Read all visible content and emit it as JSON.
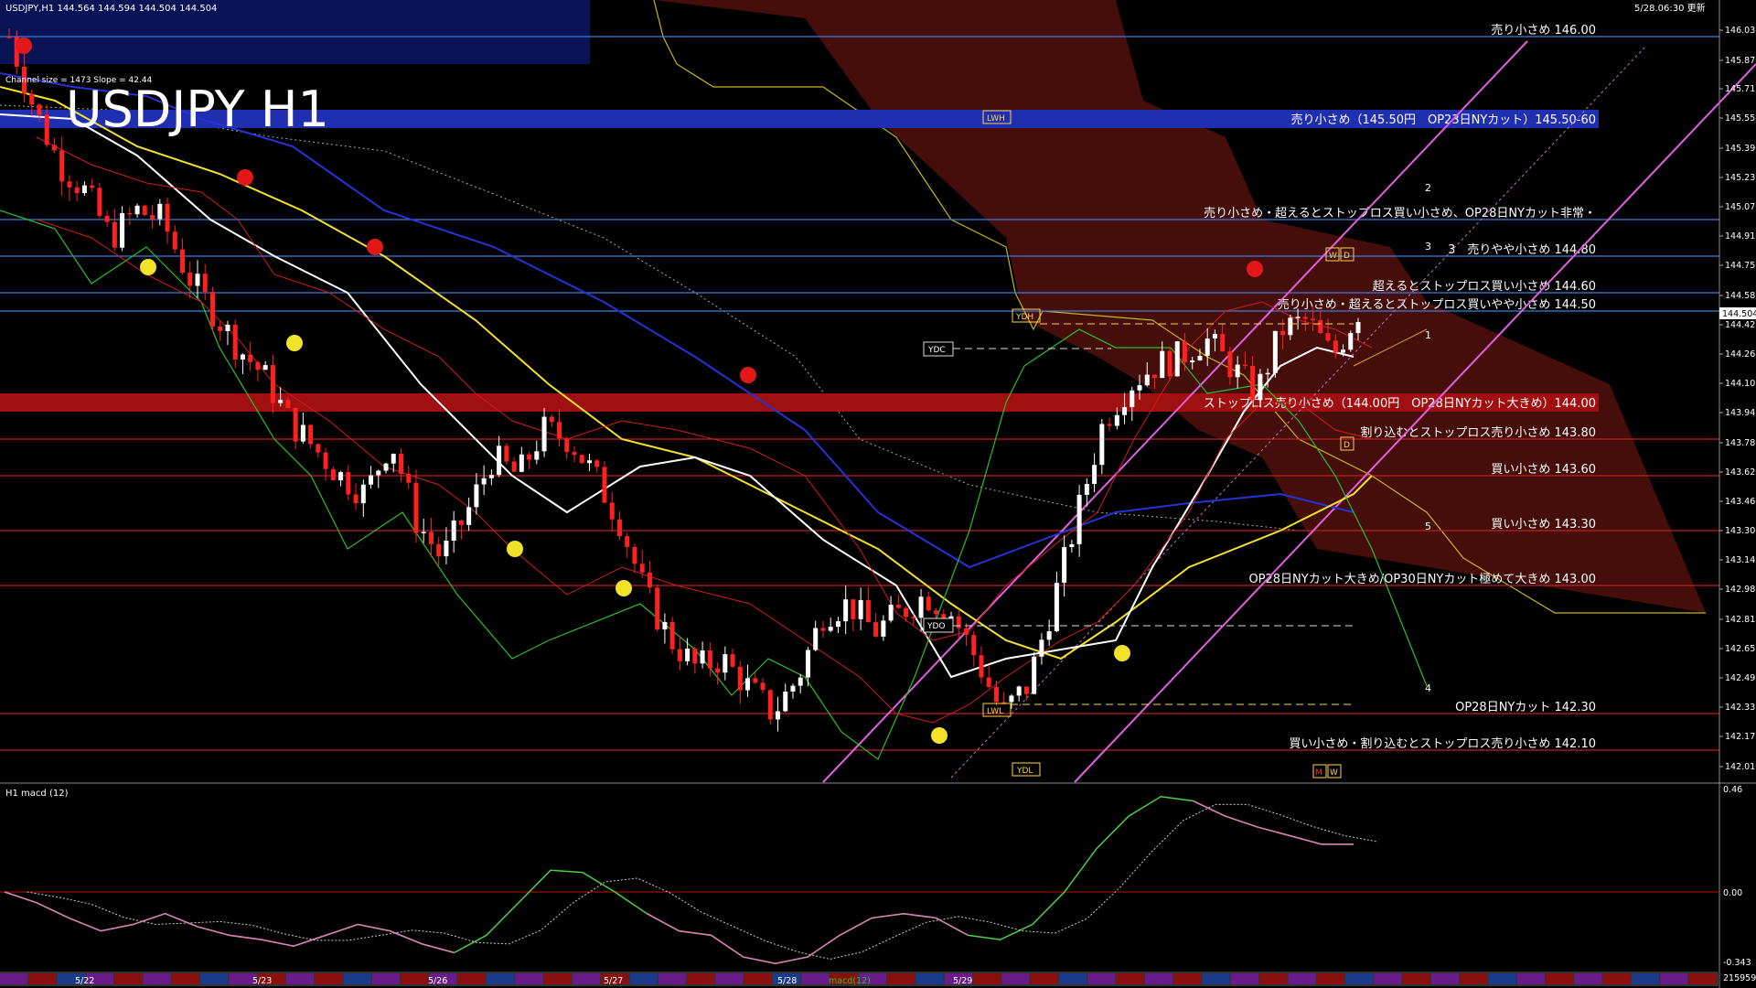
{
  "header": {
    "symbol_label": "USDJPY,H1  144.564 144.594 144.504 144.504",
    "timestamp": "5/28.06:30 更新",
    "channel_label": "Channel size = 1473  Slope = 42.44",
    "big_title": "USDJPY H1"
  },
  "price_axis": {
    "ticks": [
      "146.035",
      "145.870",
      "145.715",
      "145.555",
      "145.390",
      "145.230",
      "145.070",
      "144.910",
      "144.750",
      "144.585",
      "144.425",
      "144.265",
      "144.105",
      "143.945",
      "143.780",
      "143.620",
      "143.460",
      "143.300",
      "143.140",
      "142.980",
      "142.815",
      "142.655",
      "142.495",
      "142.335",
      "142.175",
      "142.010"
    ],
    "current_price": "144.504"
  },
  "levels": [
    {
      "text": "売り小さめ 146.00",
      "price": 146.0,
      "color": "#3c7cd8",
      "label_color": "#fff"
    },
    {
      "text": "売り小さめ（145.50円　OP23日NYカット）145.50-60",
      "price": 145.55,
      "color": "#1f2fb0",
      "label_color": "#fff"
    },
    {
      "text": "売り小さめ・超えるとストップロス買い小さめ、OP28日NYカット非常・",
      "price": 145.0,
      "color": "#3c7cd8",
      "label_color": "#fff"
    },
    {
      "text": "3　売りやや小さめ 144.80",
      "price": 144.8,
      "color": "#3c7cd8",
      "label_color": "#fff"
    },
    {
      "text": "超えるとストップロス買い小さめ 144.60",
      "price": 144.6,
      "color": "#3c7cd8",
      "label_color": "#fff"
    },
    {
      "text": "売り小さめ・超えるとストップロス買いやや小さめ 144.50",
      "price": 144.5,
      "color": "#3c7cd8",
      "label_color": "#fff"
    },
    {
      "text": "ストップロス売り小さめ（144.00円　OP28日NYカット大きめ）144.00",
      "price": 144.0,
      "color": "#a01010",
      "label_color": "#fff"
    },
    {
      "text": "割り込むとストップロス売り小さめ 143.80",
      "price": 143.8,
      "color": "#c02020",
      "label_color": "#fff"
    },
    {
      "text": "買い小さめ 143.60",
      "price": 143.6,
      "color": "#c02020",
      "label_color": "#fff"
    },
    {
      "text": "買い小さめ 143.30",
      "price": 143.3,
      "color": "#c02020",
      "label_color": "#fff"
    },
    {
      "text": "OP28日NYカット大きめ/OP30日NYカット極めて大きめ 143.00",
      "price": 143.0,
      "color": "#c02020",
      "label_color": "#fff"
    },
    {
      "text": "OP28日NYカット 142.30",
      "price": 142.3,
      "color": "#c02020",
      "label_color": "#fff"
    },
    {
      "text": "買い小さめ・割り込むとストップロス売り小さめ 142.10",
      "price": 142.1,
      "color": "#c02020",
      "label_color": "#fff"
    }
  ],
  "boxes": [
    "LWH",
    "YDH",
    "YDC",
    "YDO",
    "LWL",
    "YDL",
    "W",
    "D",
    "D",
    "M",
    "W"
  ],
  "channel_counts": [
    "1",
    "2",
    "3",
    "4",
    "5"
  ],
  "macd": {
    "label": "H1  macd (12)",
    "ticks": [
      "0.46",
      "0.00",
      "-0.343"
    ],
    "bottom_count": "215959"
  },
  "time_axis": {
    "labels": [
      "5/22",
      "5/23",
      "5/26",
      "5/27",
      "5/28",
      "5/29"
    ],
    "macd_tag": "macd(12)"
  },
  "chart_data": {
    "type": "candlestick",
    "title": "USDJPY H1",
    "ylim": [
      142.0,
      146.1
    ],
    "close_path": [
      146.0,
      145.6,
      145.3,
      145.15,
      144.9,
      145.05,
      145.0,
      144.7,
      144.5,
      144.3,
      144.15,
      143.9,
      143.75,
      143.6,
      143.5,
      143.8,
      143.35,
      143.15,
      143.4,
      143.7,
      143.6,
      143.85,
      143.8,
      143.6,
      143.35,
      142.95,
      142.7,
      142.55,
      142.6,
      142.45,
      142.3,
      142.5,
      142.85,
      142.9,
      142.75,
      142.85,
      142.95,
      142.85,
      142.6,
      142.3,
      142.45,
      142.9,
      143.4,
      143.9,
      144.1,
      144.2,
      144.25,
      144.35,
      144.2,
      144.05,
      144.4,
      144.45,
      144.25,
      144.5
    ],
    "macd_path": [
      0.0,
      -0.05,
      -0.12,
      -0.18,
      -0.15,
      -0.1,
      -0.16,
      -0.2,
      -0.22,
      -0.25,
      -0.2,
      -0.15,
      -0.18,
      -0.24,
      -0.28,
      -0.2,
      -0.05,
      0.1,
      0.09,
      0.0,
      -0.1,
      -0.18,
      -0.2,
      -0.3,
      -0.33,
      -0.3,
      -0.2,
      -0.12,
      -0.1,
      -0.12,
      -0.2,
      -0.22,
      -0.15,
      0.0,
      0.2,
      0.35,
      0.44,
      0.42,
      0.35,
      0.3,
      0.26,
      0.22,
      0.22
    ]
  }
}
